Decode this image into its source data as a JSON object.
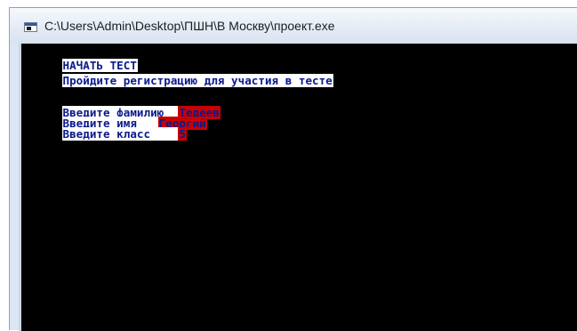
{
  "window": {
    "title": "C:\\Users\\Admin\\Desktop\\ПШН\\В Москву\\проект.exe"
  },
  "console": {
    "header_start": "НАЧАТЬ ТЕСТ",
    "header_register": "Пройдите регистрацию для участия в тесте",
    "fields": [
      {
        "prompt": "Введите фамилию  ",
        "value": "Тедеев"
      },
      {
        "prompt": "Введите имя   ",
        "value": "Георгий"
      },
      {
        "prompt": "Введите класс    ",
        "value": "5"
      }
    ]
  },
  "colors": {
    "console_bg": "#000000",
    "text": "#0b1a8c",
    "highlight_bg": "#ffffff",
    "input_bg": "#c80000"
  }
}
